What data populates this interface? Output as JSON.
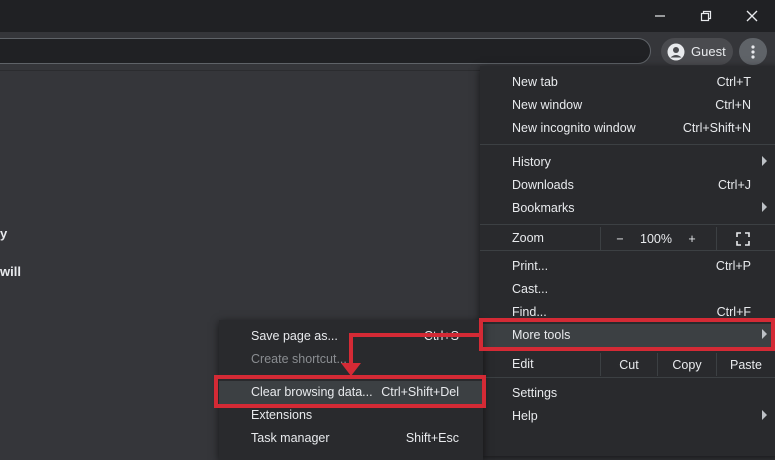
{
  "window": {
    "minimize_icon": "minimize-icon",
    "restore_icon": "restore-icon",
    "close_icon": "close-icon"
  },
  "toolbar": {
    "profile_label": "Guest",
    "profile_icon": "person-circle-icon",
    "menu_icon": "three-dots-vertical-icon"
  },
  "page": {
    "fragment_1": "y",
    "fragment_2": "will"
  },
  "menu": {
    "new_tab": {
      "label": "New tab",
      "shortcut": "Ctrl+T"
    },
    "new_window": {
      "label": "New window",
      "shortcut": "Ctrl+N"
    },
    "new_incognito": {
      "label": "New incognito window",
      "shortcut": "Ctrl+Shift+N"
    },
    "history": {
      "label": "History"
    },
    "downloads": {
      "label": "Downloads",
      "shortcut": "Ctrl+J"
    },
    "bookmarks": {
      "label": "Bookmarks"
    },
    "zoom": {
      "label": "Zoom",
      "minus": "−",
      "level": "100%",
      "plus": "+",
      "fullscreen_icon": "fullscreen-icon"
    },
    "print": {
      "label": "Print...",
      "shortcut": "Ctrl+P"
    },
    "cast": {
      "label": "Cast..."
    },
    "find": {
      "label": "Find...",
      "shortcut": "Ctrl+F"
    },
    "more_tools": {
      "label": "More tools"
    },
    "edit": {
      "label": "Edit",
      "cut": "Cut",
      "copy": "Copy",
      "paste": "Paste"
    },
    "settings": {
      "label": "Settings"
    },
    "help": {
      "label": "Help"
    }
  },
  "submenu": {
    "save_page": {
      "label": "Save page as...",
      "shortcut": "Ctrl+S"
    },
    "create_shortcut": {
      "label": "Create shortcut..."
    },
    "clear_data": {
      "label": "Clear browsing data...",
      "shortcut": "Ctrl+Shift+Del"
    },
    "extensions": {
      "label": "Extensions"
    },
    "task_manager": {
      "label": "Task manager",
      "shortcut": "Shift+Esc"
    }
  },
  "colors": {
    "highlight": "#d42a35",
    "menu_bg": "#292a2d",
    "page_bg": "#35363a",
    "titlebar_bg": "#202124"
  }
}
